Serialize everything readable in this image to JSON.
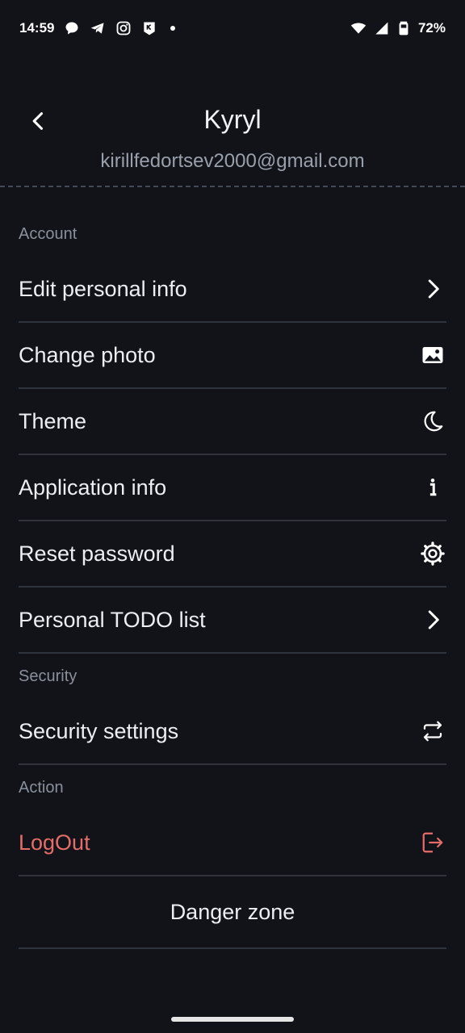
{
  "status_bar": {
    "time": "14:59",
    "battery": "72%",
    "left_icons": [
      "message-icon",
      "telegram-icon",
      "instagram-icon",
      "app-icon"
    ],
    "right_icons": [
      "wifi-icon",
      "signal-icon",
      "battery-icon"
    ]
  },
  "header": {
    "title": "Kyryl",
    "email": "kirillfedortsev2000@gmail.com"
  },
  "sections": {
    "account": {
      "title": "Account",
      "items": [
        {
          "label": "Edit personal info",
          "icon": "chevron-right-icon"
        },
        {
          "label": "Change photo",
          "icon": "image-icon"
        },
        {
          "label": "Theme",
          "icon": "moon-icon"
        },
        {
          "label": "Application info",
          "icon": "info-icon"
        },
        {
          "label": "Reset password",
          "icon": "gear-icon"
        },
        {
          "label": "Personal TODO list",
          "icon": "chevron-right-icon"
        }
      ]
    },
    "security": {
      "title": "Security",
      "items": [
        {
          "label": "Security settings",
          "icon": "swap-icon"
        }
      ]
    },
    "action": {
      "title": "Action",
      "items": [
        {
          "label": "LogOut",
          "icon": "logout-icon"
        },
        {
          "label": "Danger zone"
        }
      ]
    }
  },
  "colors": {
    "background": "#111318",
    "danger": "#e46d6a",
    "divider": "#30343c"
  }
}
